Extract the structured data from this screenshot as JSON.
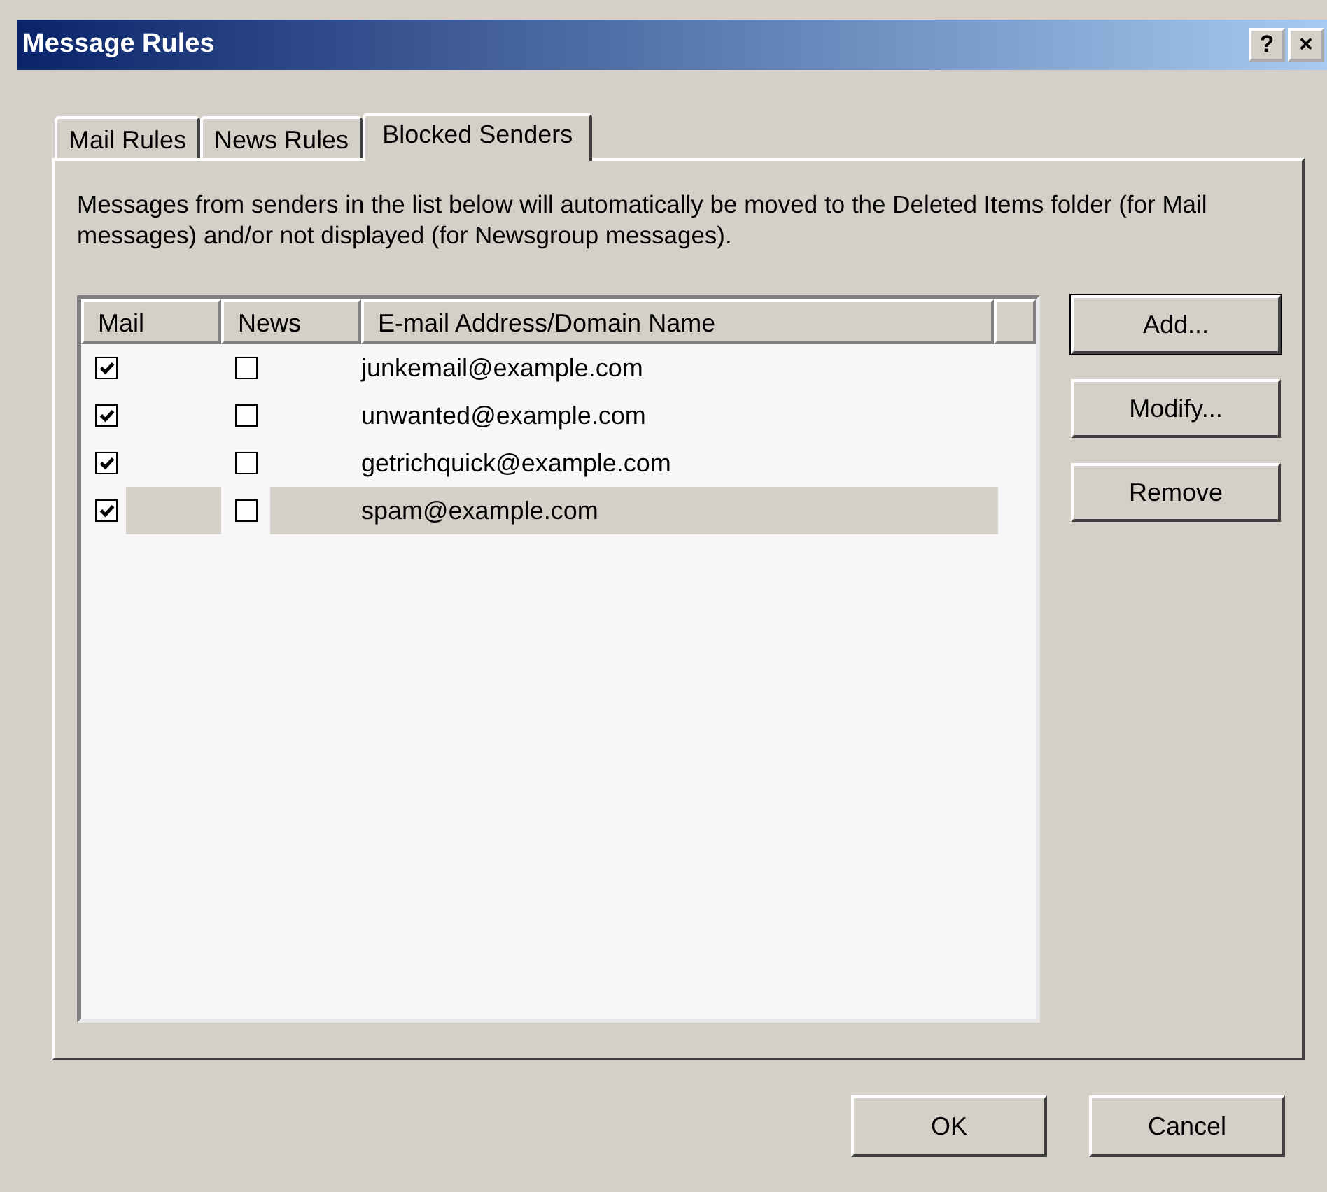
{
  "window": {
    "title": "Message Rules",
    "help_button": "?",
    "close_button": "×"
  },
  "tabs": [
    {
      "label": "Mail Rules",
      "selected": false
    },
    {
      "label": "News Rules",
      "selected": false
    },
    {
      "label": "Blocked Senders",
      "selected": true
    }
  ],
  "description": "Messages from senders in the list below will automatically be moved to the Deleted Items folder (for Mail messages) and/or not displayed (for Newsgroup messages).",
  "list": {
    "columns": [
      "Mail",
      "News",
      "E-mail Address/Domain Name"
    ],
    "rows": [
      {
        "mail": true,
        "news": false,
        "address": "junkemail@example.com",
        "selected": false
      },
      {
        "mail": true,
        "news": false,
        "address": "unwanted@example.com",
        "selected": false
      },
      {
        "mail": true,
        "news": false,
        "address": "getrichquick@example.com",
        "selected": false
      },
      {
        "mail": true,
        "news": false,
        "address": "spam@example.com",
        "selected": true
      }
    ]
  },
  "side_buttons": [
    "Add...",
    "Modify...",
    "Remove"
  ],
  "buttons": [
    "OK",
    "Cancel"
  ]
}
